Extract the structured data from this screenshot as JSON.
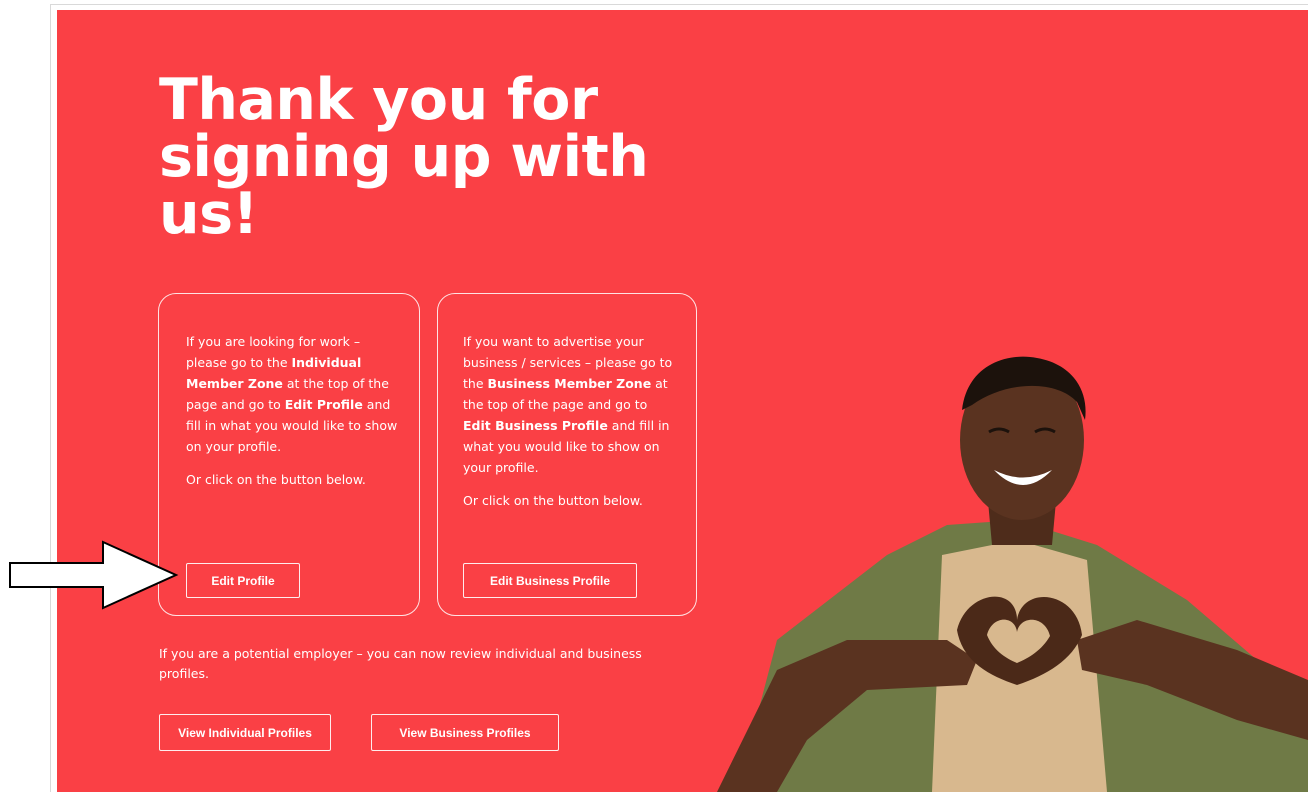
{
  "hero": {
    "headline": "Thank you for signing up with us!",
    "background_color": "#fa4045"
  },
  "cards": [
    {
      "text_parts": [
        "If you are looking for work – please go to the ",
        "Individual Member Zone",
        " at the top of the page and go to ",
        "Edit Profile",
        " and fill in what you would like to show on your profile."
      ],
      "or_line": "Or click on the button below.",
      "button_label": "Edit Profile"
    },
    {
      "text_parts": [
        "If you want to advertise your business / services – please go to the ",
        "Business Member Zone",
        " at the top of the page and go to ",
        "Edit Business Profile",
        " and fill in what you would like to show on your profile."
      ],
      "or_line": "Or click on the button below.",
      "button_label": "Edit Business Profile"
    }
  ],
  "employer": {
    "text": "If you are a potential employer – you can now review individual and business profiles.",
    "view_individual_label": "View Individual Profiles",
    "view_business_label": "View Business Profiles"
  },
  "icons": {
    "callout_arrow": "right-arrow-icon",
    "photo": "smiling-man-heart-hands"
  }
}
